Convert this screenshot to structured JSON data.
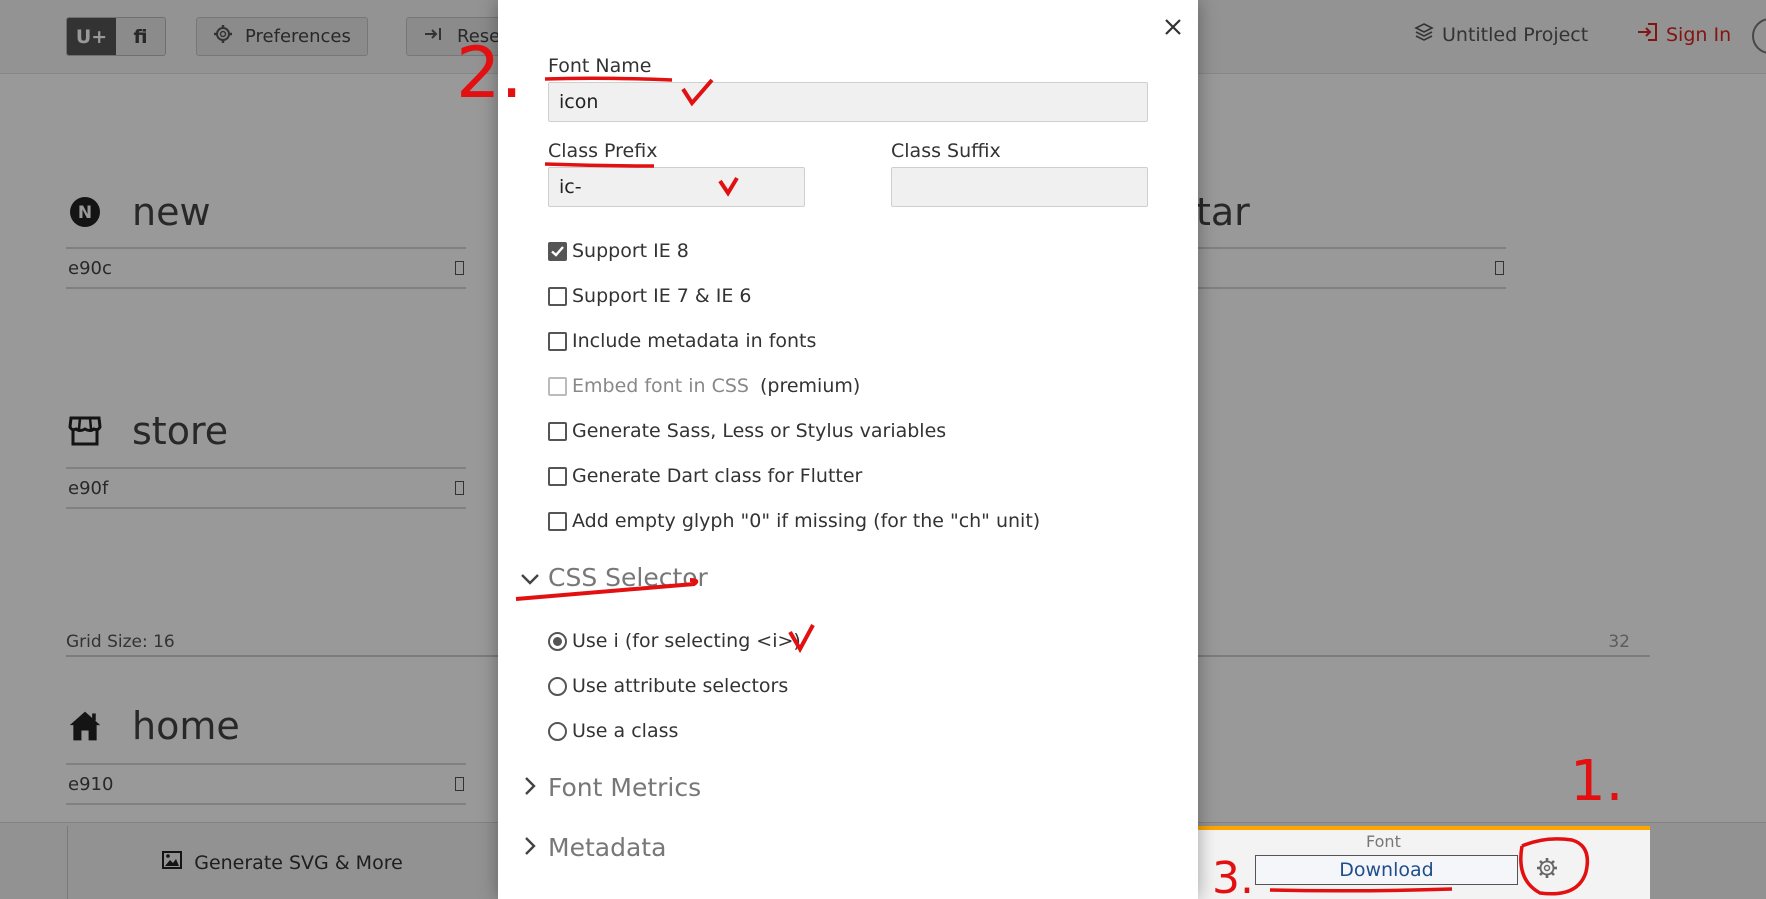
{
  "toolbar": {
    "unicode_label": "U+",
    "ligature_label": "fi",
    "preferences_label": "Preferences",
    "reset_label": "Rese",
    "project_label": "Untitled Project",
    "signin_label": "Sign In"
  },
  "glyphs": [
    {
      "name": "new",
      "code": "e90c",
      "icon": "badge-n-icon"
    },
    {
      "name": "store",
      "code": "e90f",
      "icon": "store-icon"
    },
    {
      "name": "home",
      "code": "e910",
      "icon": "home-icon"
    }
  ],
  "right_glyph": {
    "name_fragment": "tar"
  },
  "grid": {
    "label": "Grid Size: 16",
    "right_value": "32"
  },
  "bottom": {
    "generate_label": "Generate SVG & More",
    "font_tab_label": "Font",
    "download_label": "Download"
  },
  "modal": {
    "font_name_label": "Font Name",
    "font_name_value": "icon",
    "class_prefix_label": "Class Prefix",
    "class_prefix_value": "ic-",
    "class_suffix_label": "Class Suffix",
    "class_suffix_value": "",
    "options": [
      {
        "label": "Support IE 8",
        "checked": true
      },
      {
        "label": "Support IE 7 & IE 6",
        "checked": false
      },
      {
        "label": "Include metadata in fonts",
        "checked": false
      },
      {
        "label": "Embed font in CSS",
        "suffix": "(premium)",
        "checked": false,
        "disabled": true
      },
      {
        "label": "Generate Sass, Less or Stylus variables",
        "checked": false
      },
      {
        "label": "Generate Dart class for Flutter",
        "checked": false
      },
      {
        "label": "Add empty glyph \"0\" if missing (for the \"ch\" unit)",
        "checked": false
      }
    ],
    "css_selector_label": "CSS Selector",
    "selector_options": [
      {
        "label": "Use i (for selecting <i>)",
        "selected": true
      },
      {
        "label": "Use attribute selectors",
        "selected": false
      },
      {
        "label": "Use a class",
        "selected": false
      }
    ],
    "font_metrics_label": "Font Metrics",
    "metadata_label": "Metadata"
  },
  "annotations": {
    "step1": "1.",
    "step2": "2.",
    "step3": "3."
  },
  "colors": {
    "annotation_red": "#e21010",
    "accent_orange": "#ffa500",
    "link_red": "#d9241c",
    "download_text": "#1f4e8c"
  }
}
